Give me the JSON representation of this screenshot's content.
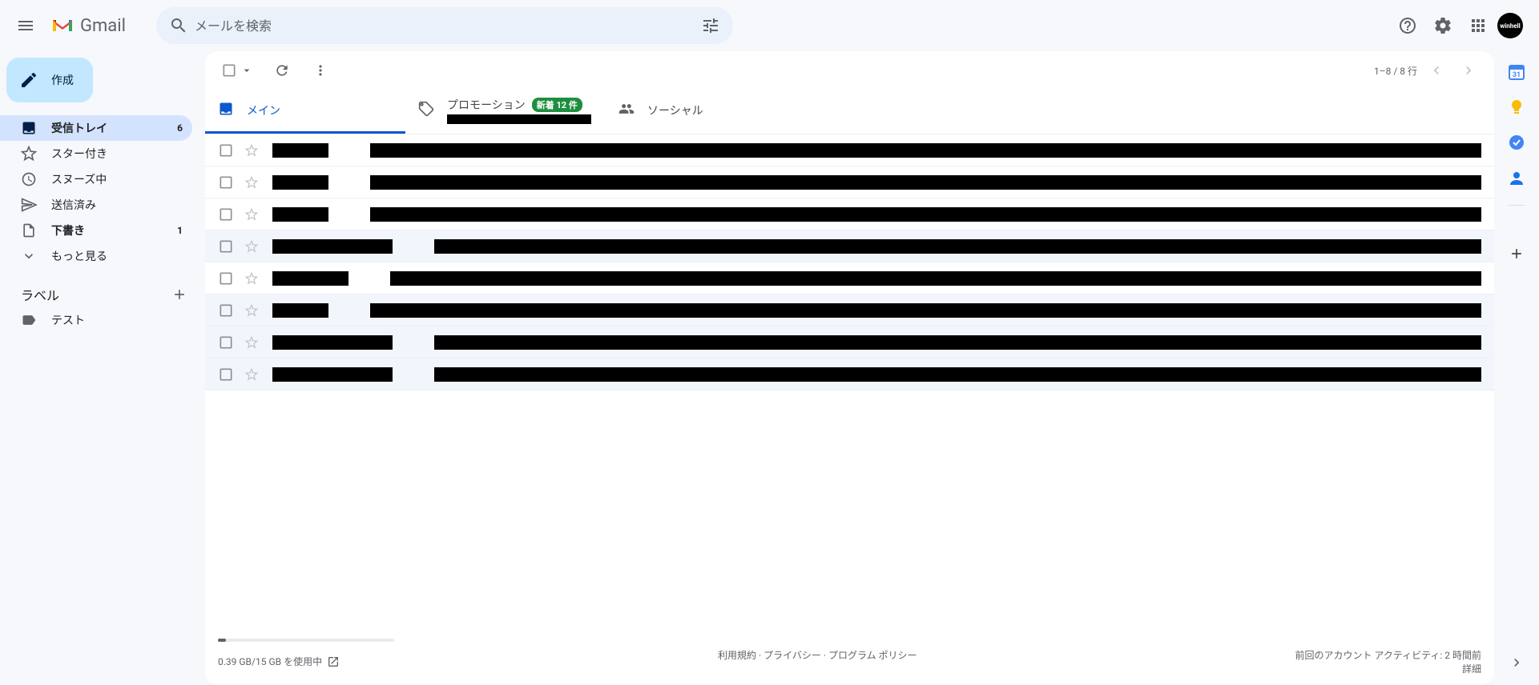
{
  "header": {
    "app_name": "Gmail",
    "search_placeholder": "メールを検索",
    "avatar_label": "winhell"
  },
  "sidebar": {
    "compose_label": "作成",
    "items": [
      {
        "label": "受信トレイ",
        "count": "6",
        "icon": "inbox"
      },
      {
        "label": "スター付き",
        "count": "",
        "icon": "star"
      },
      {
        "label": "スヌーズ中",
        "count": "",
        "icon": "clock"
      },
      {
        "label": "送信済み",
        "count": "",
        "icon": "send"
      },
      {
        "label": "下書き",
        "count": "1",
        "icon": "draft"
      },
      {
        "label": "もっと見る",
        "count": "",
        "icon": "expand"
      }
    ],
    "labels_header": "ラベル",
    "labels": [
      {
        "label": "テスト"
      }
    ]
  },
  "toolbar": {
    "page_info": "1–8 / 8 行"
  },
  "tabs": {
    "primary": "メイン",
    "promotions": "プロモーション",
    "promotions_badge": "新着 12 件",
    "social": "ソーシャル"
  },
  "mail_rows": [
    {
      "read": false,
      "sender_w": 70
    },
    {
      "read": false,
      "sender_w": 70
    },
    {
      "read": false,
      "sender_w": 70
    },
    {
      "read": true,
      "sender_w": 150
    },
    {
      "read": false,
      "sender_w": 95
    },
    {
      "read": true,
      "sender_w": 70
    },
    {
      "read": true,
      "sender_w": 150
    },
    {
      "read": true,
      "sender_w": 150
    }
  ],
  "footer": {
    "storage": "0.39 GB/15 GB を使用中",
    "terms": "利用規約",
    "privacy": "プライバシー",
    "program": "プログラム ポリシー",
    "activity": "前回のアカウント アクティビティ: 2 時間前",
    "details": "詳細"
  }
}
